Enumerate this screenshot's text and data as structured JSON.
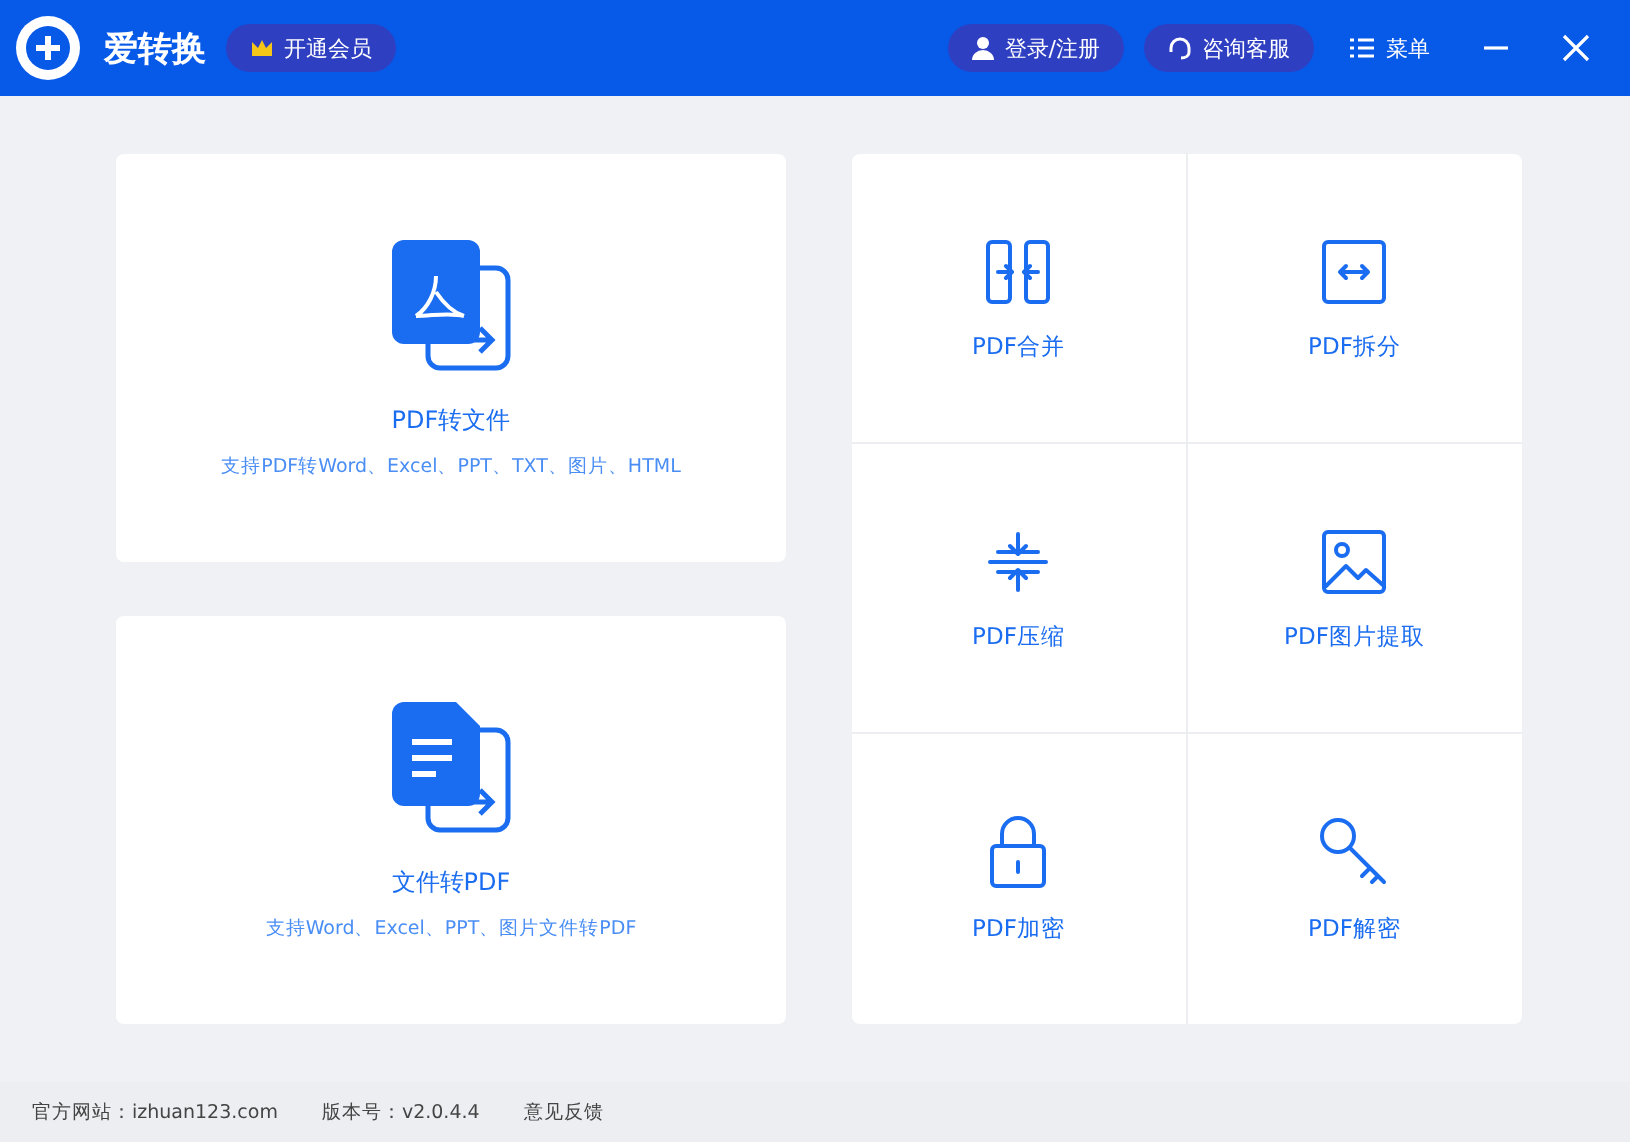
{
  "window": {
    "title": "爱转换"
  },
  "header": {
    "vip_button": "开通会员",
    "login_button": "登录/注册",
    "service_button": "咨询客服",
    "menu_button": "菜单"
  },
  "cards": [
    {
      "title": "PDF转文件",
      "description": "支持PDF转Word、Excel、PPT、TXT、图片、HTML"
    },
    {
      "title": "文件转PDF",
      "description": "支持Word、Excel、PPT、图片文件转PDF"
    }
  ],
  "tools": [
    {
      "label": "PDF合并"
    },
    {
      "label": "PDF拆分"
    },
    {
      "label": "PDF压缩"
    },
    {
      "label": "PDF图片提取"
    },
    {
      "label": "PDF加密"
    },
    {
      "label": "PDF解密"
    }
  ],
  "status_bar": {
    "website": "官方网站：izhuan123.com",
    "version": "版本号：v2.0.4.4",
    "feedback": "意见反馈"
  }
}
